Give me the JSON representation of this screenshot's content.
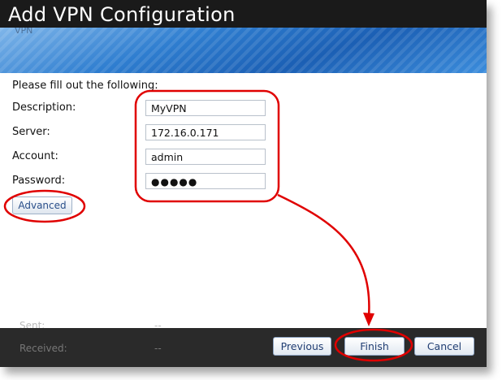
{
  "window": {
    "title": "Add VPN Configuration",
    "banner_ghost_text": "VPN"
  },
  "form": {
    "prompt": "Please fill out the following:",
    "description": {
      "label": "Description:",
      "value": "MyVPN"
    },
    "server": {
      "label": "Server:",
      "value": "172.16.0.171"
    },
    "account": {
      "label": "Account:",
      "value": "admin"
    },
    "password": {
      "label": "Password:",
      "value": "●●●●●"
    },
    "advanced_label": "Advanced"
  },
  "background_ghost": {
    "row1_label": "Sent:",
    "row1_value": "--",
    "row2_label": "Received:",
    "row2_value": "--"
  },
  "footer": {
    "previous_label": "Previous",
    "finish_label": "Finish",
    "cancel_label": "Cancel"
  },
  "annotation_color": "#e00000"
}
